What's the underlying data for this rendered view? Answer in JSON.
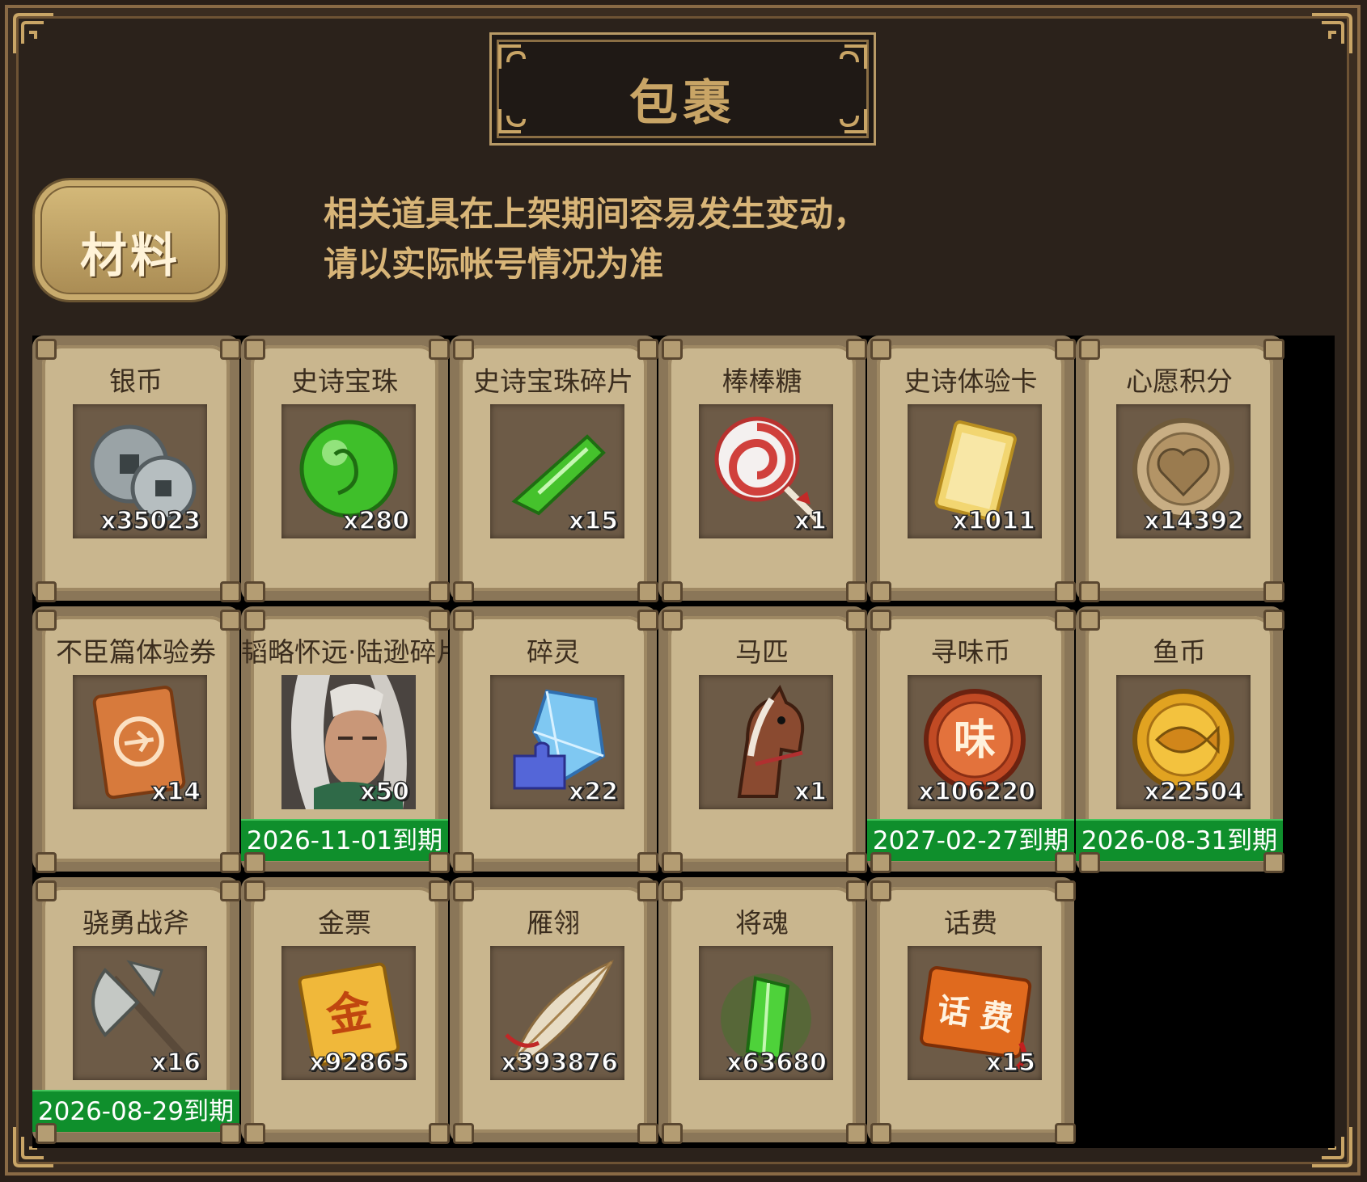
{
  "header": {
    "title": "包裹"
  },
  "tab": {
    "label": "材料"
  },
  "notice": {
    "line1": "相关道具在上架期间容易发生变动，",
    "line2": "请以实际帐号情况为准"
  },
  "items": [
    {
      "name": "银币",
      "qty": "x35023",
      "icon": "silver-coin-icon"
    },
    {
      "name": "史诗宝珠",
      "qty": "x280",
      "icon": "green-orb-icon"
    },
    {
      "name": "史诗宝珠碎片",
      "qty": "x15",
      "icon": "green-shard-icon"
    },
    {
      "name": "棒棒糖",
      "qty": "x1",
      "icon": "lollipop-icon"
    },
    {
      "name": "史诗体验卡",
      "qty": "x1011",
      "icon": "gold-card-icon"
    },
    {
      "name": "心愿积分",
      "qty": "x14392",
      "icon": "heart-coin-icon"
    },
    {
      "name": "不臣篇体验券",
      "qty": "x14",
      "icon": "ticket-icon"
    },
    {
      "name": "韬略怀远·陆逊碎片",
      "qty": "x50",
      "icon": "hero-portrait-icon",
      "expiry": "2026-11-01到期"
    },
    {
      "name": "碎灵",
      "qty": "x22",
      "icon": "crystal-puzzle-icon"
    },
    {
      "name": "马匹",
      "qty": "x1",
      "icon": "horse-icon"
    },
    {
      "name": "寻味币",
      "qty": "x106220",
      "icon": "flavor-coin-icon",
      "expiry": "2027-02-27到期"
    },
    {
      "name": "鱼币",
      "qty": "x22504",
      "icon": "fish-coin-icon",
      "expiry": "2026-08-31到期"
    },
    {
      "name": "骁勇战斧",
      "qty": "x16",
      "icon": "battle-axe-icon",
      "expiry": "2026-08-29到期"
    },
    {
      "name": "金票",
      "qty": "x92865",
      "icon": "gold-ticket-icon"
    },
    {
      "name": "雁翎",
      "qty": "x393876",
      "icon": "feather-icon"
    },
    {
      "name": "将魂",
      "qty": "x63680",
      "icon": "spirit-crystal-icon"
    },
    {
      "name": "话费",
      "qty": "x15",
      "icon": "phone-credit-icon"
    }
  ],
  "icon_text": {
    "flavor": "味",
    "gold": "金",
    "phone": "话 费"
  }
}
